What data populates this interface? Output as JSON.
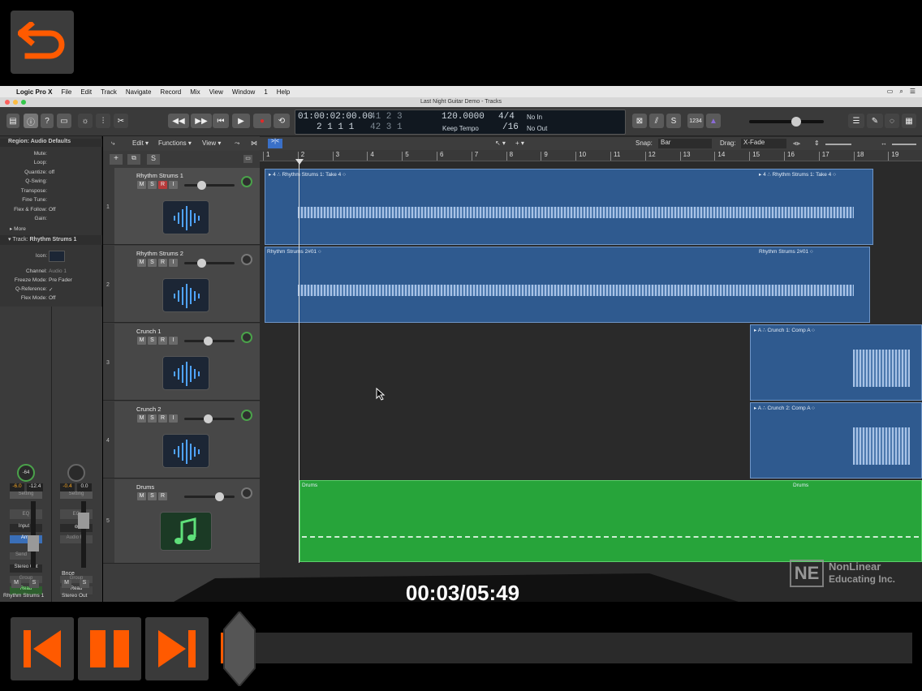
{
  "overlay": {
    "timecode": "00:03/05:49",
    "watermark_line1": "NonLinear",
    "watermark_line2": "Educating Inc."
  },
  "menubar": {
    "app": "Logic Pro X",
    "items": [
      "File",
      "Edit",
      "Track",
      "Navigate",
      "Record",
      "Mix",
      "View",
      "Window",
      "1",
      "Help"
    ]
  },
  "window": {
    "title": "Last Night Guitar Demo - Tracks"
  },
  "lcd": {
    "time": "01:00:02:00.00",
    "bars": "41  2  3",
    "position": "2  1  1      1",
    "bars2": "42  3  1",
    "tempo": "120.0000",
    "tempo_label": "Keep Tempo",
    "sig": "4/4",
    "div": "/16",
    "in": "No In",
    "out": "No Out",
    "key": "1234"
  },
  "tracksbar": {
    "edit": "Edit",
    "functions": "Functions",
    "view": "View",
    "snap_label": "Snap:",
    "snap": "Bar",
    "drag_label": "Drag:",
    "drag": "X-Fade"
  },
  "inspector": {
    "region_header": "Region: Audio Defaults",
    "region_rows": [
      {
        "k": "Mute:",
        "v": ""
      },
      {
        "k": "Loop:",
        "v": ""
      },
      {
        "k": "Quantize:",
        "v": "off"
      },
      {
        "k": "Q-Swing:",
        "v": ""
      },
      {
        "k": "Transpose:",
        "v": ""
      },
      {
        "k": "Fine Tune:",
        "v": ""
      },
      {
        "k": "Flex & Follow:",
        "v": "Off"
      },
      {
        "k": "Gain:",
        "v": ""
      }
    ],
    "more": "More",
    "track_header": "Track:",
    "track_name": "Rhythm Strums 1",
    "track_rows": [
      {
        "k": "Icon:",
        "v": ""
      },
      {
        "k": "Channel:",
        "v": "Audio 1"
      },
      {
        "k": "Freeze Mode:",
        "v": "Pre Fader"
      },
      {
        "k": "Q-Reference:",
        "v": "✓"
      },
      {
        "k": "Flex Mode:",
        "v": "Off"
      }
    ],
    "strip1": {
      "setting": "Setting",
      "eq": "EQ",
      "input": "Input 3",
      "amp": "Amp",
      "send": "Send",
      "output": "Stereo Out",
      "group": "Group",
      "read": "Read",
      "pan": "-64",
      "vol1": "-6.0",
      "vol2": "-12.4",
      "m": "M",
      "s": "S",
      "name": "Rhythm Strums 1"
    },
    "strip2": {
      "setting": "Setting",
      "eq": "EQ",
      "audiofx": "Audio FX",
      "group": "Group",
      "read": "Read",
      "vol1": "-0.4",
      "vol2": "0.0",
      "bnce": "Bnce",
      "m": "M",
      "s": "S",
      "name": "Stereo Out"
    }
  },
  "tracks": [
    {
      "num": "1",
      "name": "Rhythm Strums 1",
      "buttons": [
        "M",
        "S",
        "R",
        "I"
      ]
    },
    {
      "num": "2",
      "name": "Rhythm Strums 2",
      "buttons": [
        "M",
        "S",
        "R",
        "I"
      ]
    },
    {
      "num": "3",
      "name": "Crunch 1",
      "buttons": [
        "M",
        "S",
        "R",
        "I"
      ]
    },
    {
      "num": "4",
      "name": "Crunch 2",
      "buttons": [
        "M",
        "S",
        "R",
        "I"
      ]
    },
    {
      "num": "5",
      "name": "Drums",
      "buttons": [
        "M",
        "S",
        "R"
      ]
    }
  ],
  "ruler": [
    "1",
    "2",
    "3",
    "4",
    "5",
    "6",
    "7",
    "8",
    "9",
    "10",
    "11",
    "12",
    "13",
    "14",
    "15",
    "16",
    "17",
    "18",
    "19"
  ],
  "regions": [
    {
      "a": "Rhythm Strums 1: Take 4",
      "b": "Rhythm Strums 1: Take 4"
    },
    {
      "a": "Rhythm Strums 2#01",
      "b": "Rhythm Strums 2#01"
    },
    {
      "a": "Crunch 1: Comp A"
    },
    {
      "a": "Crunch 2: Comp A"
    },
    {
      "a": "Drums",
      "b": "Drums"
    }
  ],
  "colors": {
    "orange": "#ff5a00",
    "region_blue": "#2f5a8f",
    "drums_green": "#27a43a"
  }
}
